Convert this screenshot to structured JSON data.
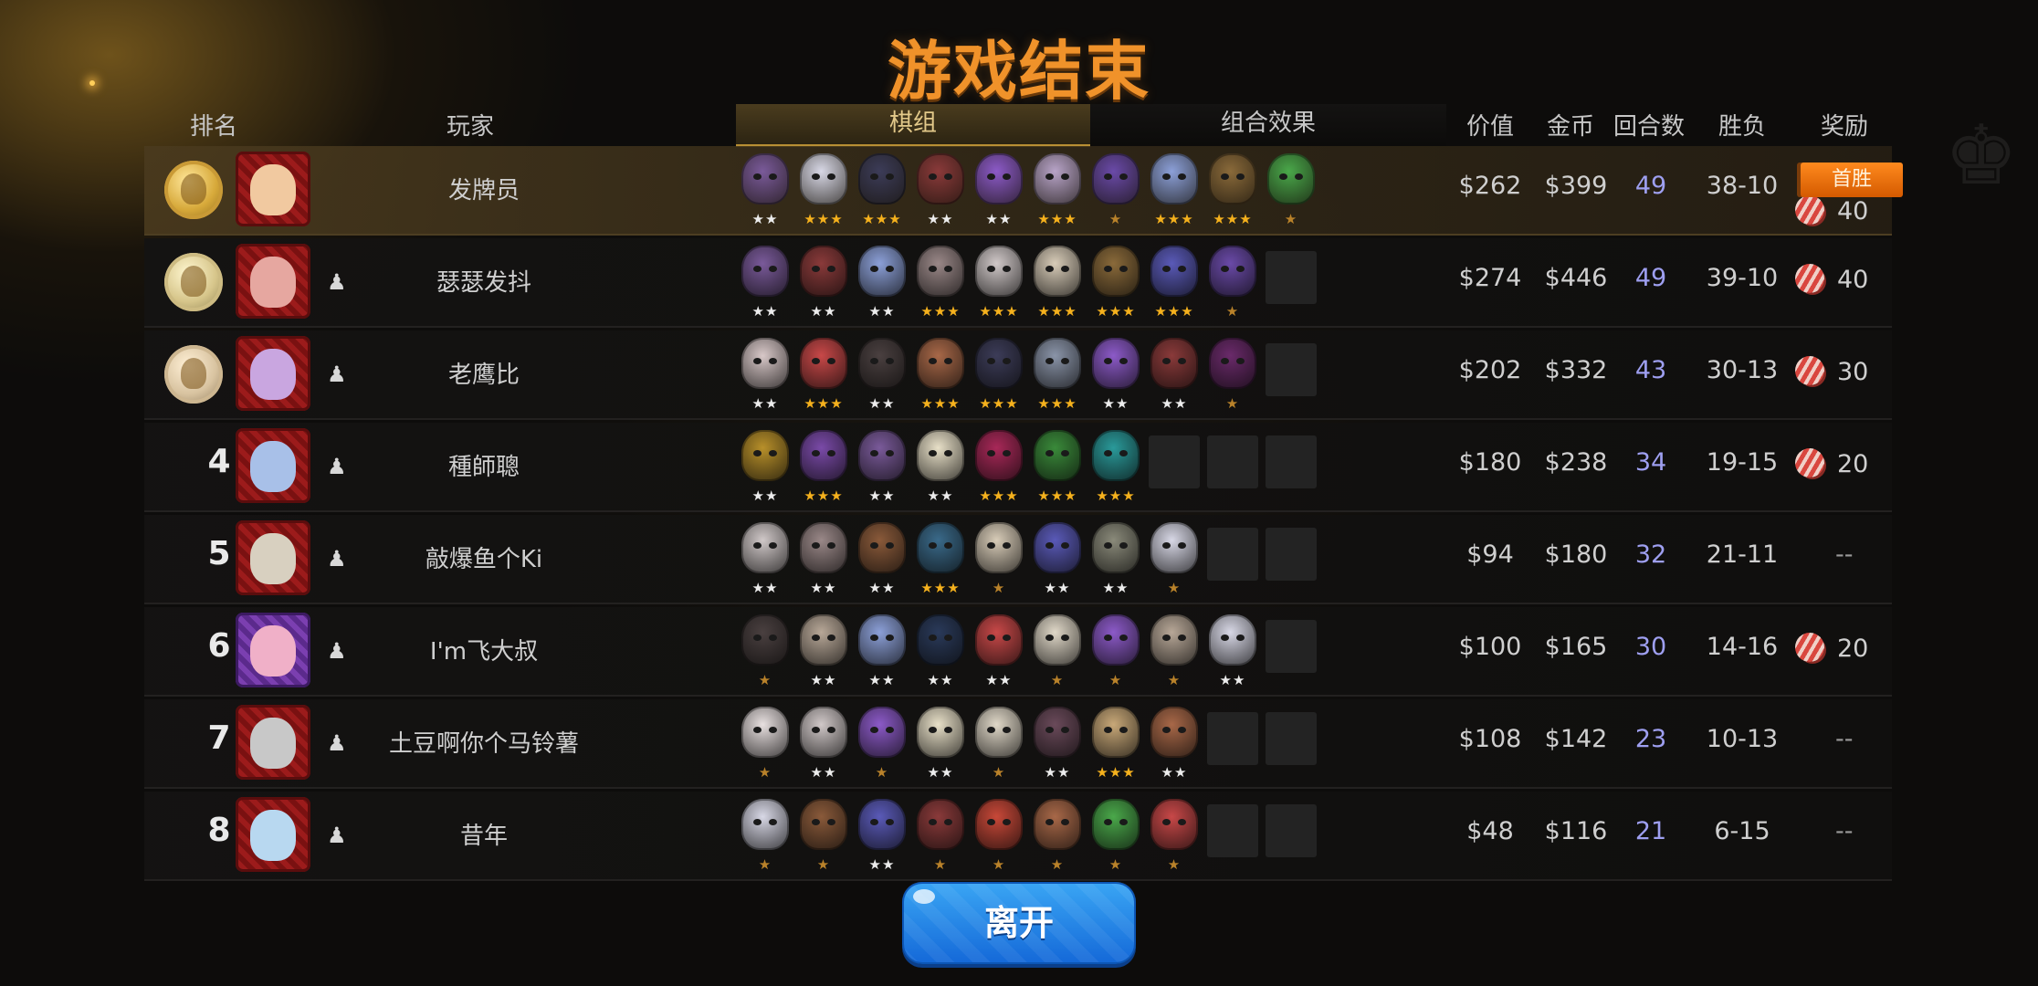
{
  "title": "游戏结束",
  "headers": {
    "rank": "排名",
    "player": "玩家",
    "lineup_tab": "棋组",
    "combo_tab": "组合效果",
    "value": "价值",
    "gold": "金币",
    "rounds": "回合数",
    "win_loss": "胜负",
    "reward": "奖励"
  },
  "first_win_badge": "首胜",
  "leave_button": "离开",
  "colors": {
    "title": "#f0922a",
    "rounds": "#9e9ff0",
    "leave_button": "#2a8ae6",
    "first_win_badge": "#f07a10"
  },
  "players": [
    {
      "rank": "1",
      "rank_display": "gold-medal-icon",
      "name": "发牌员",
      "value": "$262",
      "gold": "$399",
      "rounds": "49",
      "win_loss": "38-10",
      "reward": "40",
      "first_win": true,
      "add_friend": false,
      "heroes": [
        {
          "icon": "horned-ogre",
          "color": "#7a5a9a",
          "stars": 2
        },
        {
          "icon": "white-yeti",
          "color": "#d8d8e6",
          "stars": 3
        },
        {
          "icon": "hooded-assassin",
          "color": "#3c3c58",
          "stars": 3
        },
        {
          "icon": "red-bandana-dwarf",
          "color": "#8a3a3a",
          "stars": 2
        },
        {
          "icon": "purple-witch",
          "color": "#8c5ac8",
          "stars": 2
        },
        {
          "icon": "pale-ogre",
          "color": "#b8a4c8",
          "stars": 3
        },
        {
          "icon": "purple-knight",
          "color": "#6a4aa8",
          "stars": 1
        },
        {
          "icon": "blue-yeti",
          "color": "#8ca0d8",
          "stars": 3
        },
        {
          "icon": "tree-spirit",
          "color": "#8a6a3a",
          "stars": 3
        },
        {
          "icon": "goblin-king",
          "color": "#4aa84a",
          "stars": 1
        }
      ]
    },
    {
      "rank": "2",
      "rank_display": "silver-medal-icon",
      "name": "瑟瑟发抖",
      "value": "$274",
      "gold": "$446",
      "rounds": "49",
      "win_loss": "39-10",
      "reward": "40",
      "first_win": false,
      "add_friend": true,
      "heroes": [
        {
          "icon": "horned-ogre",
          "color": "#7a5a9a",
          "stars": 2
        },
        {
          "icon": "red-bandana-dwarf",
          "color": "#8a3a3a",
          "stars": 2
        },
        {
          "icon": "blue-yeti",
          "color": "#8ca0d8",
          "stars": 2
        },
        {
          "icon": "grey-demon",
          "color": "#9a8888",
          "stars": 3
        },
        {
          "icon": "white-mage",
          "color": "#d0c8c8",
          "stars": 3
        },
        {
          "icon": "skull-beast",
          "color": "#d8ccb8",
          "stars": 3
        },
        {
          "icon": "tree-spirit",
          "color": "#8a6a3a",
          "stars": 3
        },
        {
          "icon": "blue-bat",
          "color": "#5a5ab8",
          "stars": 3
        },
        {
          "icon": "purple-knight",
          "color": "#6a4aa8",
          "stars": 1
        }
      ]
    },
    {
      "rank": "3",
      "rank_display": "bronze-medal-icon",
      "name": "老鹰比",
      "value": "$202",
      "gold": "$332",
      "rounds": "43",
      "win_loss": "30-13",
      "reward": "30",
      "first_win": false,
      "add_friend": true,
      "heroes": [
        {
          "icon": "pale-ogre",
          "color": "#d8c8c8",
          "stars": 2
        },
        {
          "icon": "red-brute",
          "color": "#c84848",
          "stars": 3
        },
        {
          "icon": "dark-swordsman",
          "color": "#4a4040",
          "stars": 2
        },
        {
          "icon": "pirate-boar",
          "color": "#a86848",
          "stars": 3
        },
        {
          "icon": "hooded-assassin",
          "color": "#3c3c58",
          "stars": 3
        },
        {
          "icon": "grey-troll",
          "color": "#8a94a8",
          "stars": 3
        },
        {
          "icon": "purple-witch",
          "color": "#8c5ac8",
          "stars": 2
        },
        {
          "icon": "red-bandana-dwarf",
          "color": "#8a3a3a",
          "stars": 2
        },
        {
          "icon": "shadow-wraith",
          "color": "#6a2a6a",
          "stars": 1
        }
      ]
    },
    {
      "rank": "4",
      "rank_display": "4",
      "name": "種師聰",
      "value": "$180",
      "gold": "$238",
      "rounds": "34",
      "win_loss": "19-15",
      "reward": "20",
      "first_win": false,
      "add_friend": true,
      "heroes": [
        {
          "icon": "golden-pharaoh",
          "color": "#b8902a",
          "stars": 2
        },
        {
          "icon": "purple-wizard",
          "color": "#7a4aa8",
          "stars": 3
        },
        {
          "icon": "horned-ogre",
          "color": "#7a5a9a",
          "stars": 2
        },
        {
          "icon": "elf-priestess",
          "color": "#e8e0c8",
          "stars": 2
        },
        {
          "icon": "crimson-demon",
          "color": "#a82858",
          "stars": 3
        },
        {
          "icon": "green-rogue",
          "color": "#3a8a3a",
          "stars": 3
        },
        {
          "icon": "teal-robot",
          "color": "#2a9a9a",
          "stars": 3
        }
      ]
    },
    {
      "rank": "5",
      "rank_display": "5",
      "name": "敲爆鱼个Ki",
      "value": "$94",
      "gold": "$180",
      "rounds": "32",
      "win_loss": "21-11",
      "reward": "--",
      "first_win": false,
      "add_friend": true,
      "heroes": [
        {
          "icon": "white-mage",
          "color": "#d0c8c8",
          "stars": 2
        },
        {
          "icon": "grey-demon",
          "color": "#9a8888",
          "stars": 2
        },
        {
          "icon": "brown-warrior",
          "color": "#8a5a3a",
          "stars": 2
        },
        {
          "icon": "green-mech",
          "color": "#3a6a8a",
          "stars": 3
        },
        {
          "icon": "skull-beast",
          "color": "#d8ccb8",
          "stars": 1
        },
        {
          "icon": "blue-bat",
          "color": "#5a5ab8",
          "stars": 2
        },
        {
          "icon": "skull-knight",
          "color": "#8a8a7a",
          "stars": 2
        },
        {
          "icon": "white-yeti",
          "color": "#d8d8e6",
          "stars": 1
        }
      ]
    },
    {
      "rank": "6",
      "rank_display": "6",
      "name": "I'm飞大叔",
      "value": "$100",
      "gold": "$165",
      "rounds": "30",
      "win_loss": "14-16",
      "reward": "20",
      "first_win": false,
      "add_friend": true,
      "heroes": [
        {
          "icon": "dark-swordsman",
          "color": "#4a4040",
          "stars": 1
        },
        {
          "icon": "old-monk",
          "color": "#b8a898",
          "stars": 2
        },
        {
          "icon": "blue-yeti",
          "color": "#8ca0d8",
          "stars": 2
        },
        {
          "icon": "void-hood",
          "color": "#2a3a5a",
          "stars": 2
        },
        {
          "icon": "red-brute",
          "color": "#c84848",
          "stars": 2
        },
        {
          "icon": "white-sage",
          "color": "#e0d8c8",
          "stars": 1
        },
        {
          "icon": "purple-witch",
          "color": "#8c5ac8",
          "stars": 1
        },
        {
          "icon": "old-monk",
          "color": "#b8a898",
          "stars": 1
        },
        {
          "icon": "white-yeti",
          "color": "#d8d8e6",
          "stars": 2
        }
      ]
    },
    {
      "rank": "7",
      "rank_display": "7",
      "name": "土豆啊你个马铃薯",
      "value": "$108",
      "gold": "$142",
      "rounds": "23",
      "win_loss": "10-13",
      "reward": "--",
      "first_win": false,
      "add_friend": true,
      "heroes": [
        {
          "icon": "white-goat",
          "color": "#e8e0e0",
          "stars": 1
        },
        {
          "icon": "white-mage",
          "color": "#d0c8c8",
          "stars": 2
        },
        {
          "icon": "purple-witch",
          "color": "#8c5ac8",
          "stars": 1
        },
        {
          "icon": "pale-egg",
          "color": "#e8e0c8",
          "stars": 2
        },
        {
          "icon": "white-sage",
          "color": "#e0d8c8",
          "stars": 1
        },
        {
          "icon": "dark-ogre",
          "color": "#6a4a5a",
          "stars": 2
        },
        {
          "icon": "viking-chief",
          "color": "#c8a878",
          "stars": 3
        },
        {
          "icon": "goggle-dwarf",
          "color": "#a86848",
          "stars": 2
        }
      ]
    },
    {
      "rank": "8",
      "rank_display": "8",
      "name": "昔年",
      "value": "$48",
      "gold": "$116",
      "rounds": "21",
      "win_loss": "6-15",
      "reward": "--",
      "first_win": false,
      "add_friend": true,
      "heroes": [
        {
          "icon": "white-yeti",
          "color": "#d8d8e6",
          "stars": 1
        },
        {
          "icon": "brown-warrior",
          "color": "#8a5a3a",
          "stars": 1
        },
        {
          "icon": "blue-bat",
          "color": "#5a5ab8",
          "stars": 2
        },
        {
          "icon": "red-bandana-dwarf",
          "color": "#8a3a3a",
          "stars": 1
        },
        {
          "icon": "tribal-mask",
          "color": "#c84838",
          "stars": 1
        },
        {
          "icon": "pirate-boar",
          "color": "#a86848",
          "stars": 1
        },
        {
          "icon": "goblin-king",
          "color": "#4aa84a",
          "stars": 1
        },
        {
          "icon": "red-brute",
          "color": "#c84848",
          "stars": 1
        }
      ]
    }
  ]
}
